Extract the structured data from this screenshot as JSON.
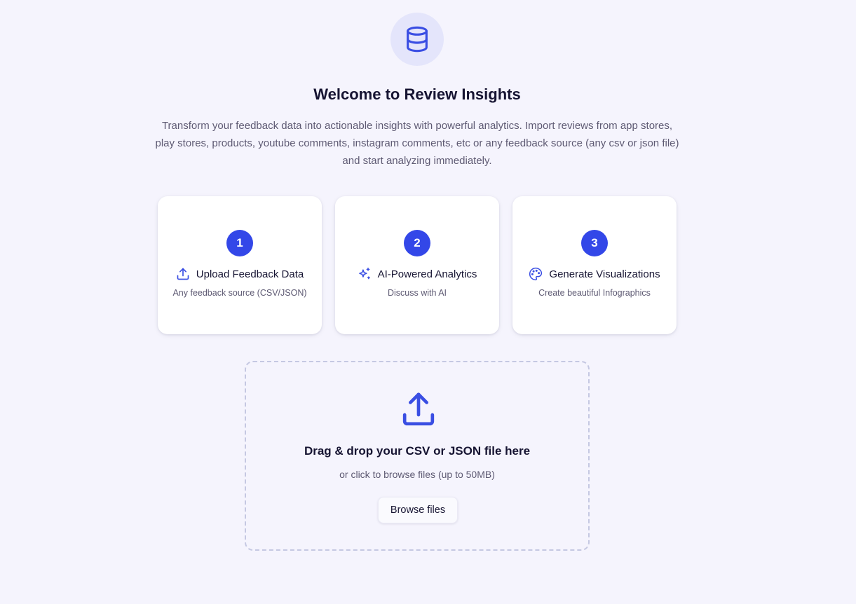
{
  "header": {
    "icon": "database-icon",
    "title": "Welcome to Review Insights",
    "subtitle": "Transform your feedback data into actionable insights with powerful analytics. Import reviews from app stores, play stores, products, youtube comments, instagram comments, etc or any feedback source (any csv or json file) and start analyzing immediately."
  },
  "steps": [
    {
      "number": "1",
      "icon": "upload-icon",
      "title": "Upload Feedback Data",
      "description": "Any feedback source (CSV/JSON)"
    },
    {
      "number": "2",
      "icon": "sparkles-icon",
      "title": "AI-Powered Analytics",
      "description": "Discuss with AI"
    },
    {
      "number": "3",
      "icon": "palette-icon",
      "title": "Generate Visualizations",
      "description": "Create beautiful Infographics"
    }
  ],
  "dropzone": {
    "icon": "upload-icon",
    "title": "Drag & drop your CSV or JSON file here",
    "subtitle": "or click to browse files (up to 50MB)",
    "button_label": "Browse files"
  },
  "colors": {
    "background": "#f5f4fd",
    "accent": "#3347e8",
    "icon_circle": "#e4e5fb",
    "text_primary": "#161432",
    "text_secondary": "#5e5a73",
    "dashed_border": "#c5c8e2"
  }
}
